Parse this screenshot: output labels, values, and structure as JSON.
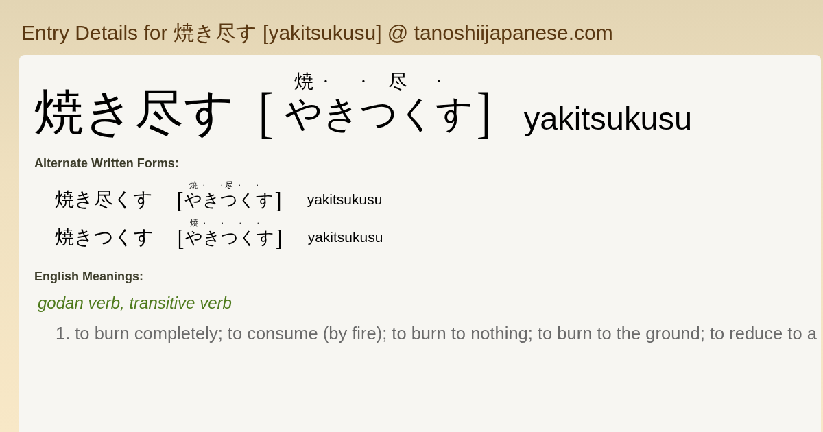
{
  "page_title": "Entry Details for 焼き尽す [yakitsukusu] @ tanoshiijapanese.com",
  "entry": {
    "written": "焼き尽す",
    "bracket_open": "[",
    "reading": [
      {
        "kana": "や",
        "kind": "kanji",
        "ruby": "焼"
      },
      {
        "kana": "き",
        "kind": "kana",
        "ruby": "·"
      },
      {
        "kana": "つく",
        "kind": "kanji",
        "ruby": "尽",
        "dot": "·"
      },
      {
        "kana": "す",
        "kind": "kana",
        "ruby": "·"
      }
    ],
    "bracket_close": "]",
    "romaji": "yakitsukusu"
  },
  "alternate_forms": {
    "heading": "Alternate Written Forms:",
    "items": [
      {
        "written": "焼き尽くす",
        "bracket_open": "[",
        "reading": [
          {
            "kana": "や",
            "kind": "kanji",
            "ruby": "焼"
          },
          {
            "kana": "き",
            "kind": "kana",
            "ruby": "·"
          },
          {
            "kana": "つ",
            "kind": "kanji",
            "ruby": "尽",
            "dot": "·"
          },
          {
            "kana": "く",
            "kind": "kana",
            "ruby": "·"
          },
          {
            "kana": "す",
            "kind": "kana",
            "ruby": "·"
          }
        ],
        "bracket_close": "]",
        "romaji": "yakitsukusu"
      },
      {
        "written": "焼きつくす",
        "bracket_open": "[",
        "reading": [
          {
            "kana": "や",
            "kind": "kanji",
            "ruby": "焼"
          },
          {
            "kana": "き",
            "kind": "kana",
            "ruby": "·"
          },
          {
            "kana": "つ",
            "kind": "kana",
            "ruby": "·"
          },
          {
            "kana": "く",
            "kind": "kana",
            "ruby": "·"
          },
          {
            "kana": "す",
            "kind": "kana",
            "ruby": "·"
          }
        ],
        "bracket_close": "]",
        "romaji": "yakitsukusu"
      }
    ]
  },
  "meanings": {
    "heading": "English Meanings:",
    "part_of_speech": "godan verb, transitive verb",
    "senses": [
      {
        "number": "1.",
        "text": "to burn completely; to consume (by fire); to burn to nothing; to burn to the ground; to reduce to a"
      }
    ]
  }
}
